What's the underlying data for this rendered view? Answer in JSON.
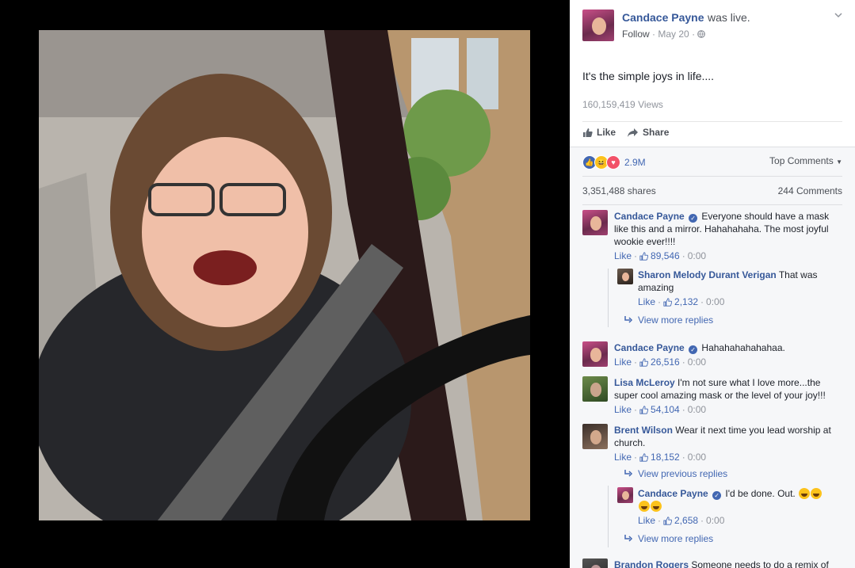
{
  "post": {
    "author": "Candace Payne",
    "action": "was live.",
    "follow": "Follow",
    "date": "May 20",
    "privacy_icon": "globe-icon",
    "caption": "It's the simple joys in life....",
    "views": "160,159,419 Views"
  },
  "actions": {
    "like": "Like",
    "share": "Share"
  },
  "stats": {
    "reactions_count": "2.9M",
    "sort": "Top Comments",
    "shares": "3,351,488 shares",
    "comments": "244 Comments"
  },
  "comments": [
    {
      "name": "Candace Payne",
      "text": "Everyone should have a mask like this and a mirror. Hahahahaha. The most joyful wookie ever!!!!",
      "like": "Like",
      "likes": "89,546",
      "time": "0:00"
    },
    {
      "name": "Sharon Melody Durant Verigan",
      "text": "That was amazing",
      "like": "Like",
      "likes": "2,132",
      "time": "0:00"
    },
    {
      "more": "View more replies"
    },
    {
      "name": "Candace Payne",
      "text": "Hahahahahahahaa.",
      "like": "Like",
      "likes": "26,516",
      "time": "0:00"
    },
    {
      "name": "Lisa McLeroy",
      "text": "I'm not sure what I love more...the super cool amazing mask or the level of your joy!!!",
      "like": "Like",
      "likes": "54,104",
      "time": "0:00"
    },
    {
      "name": "Brent Wilson",
      "text": "Wear it next time you lead worship at church.",
      "like": "Like",
      "likes": "18,152",
      "time": "0:00"
    },
    {
      "more": "View previous replies"
    },
    {
      "name": "Candace Payne",
      "text": "I'd be done. Out.",
      "like": "Like",
      "likes": "2,658",
      "time": "0:00"
    },
    {
      "more": "View more replies"
    },
    {
      "name": "Brandon Rogers",
      "text": "Someone needs to do a remix of"
    }
  ]
}
